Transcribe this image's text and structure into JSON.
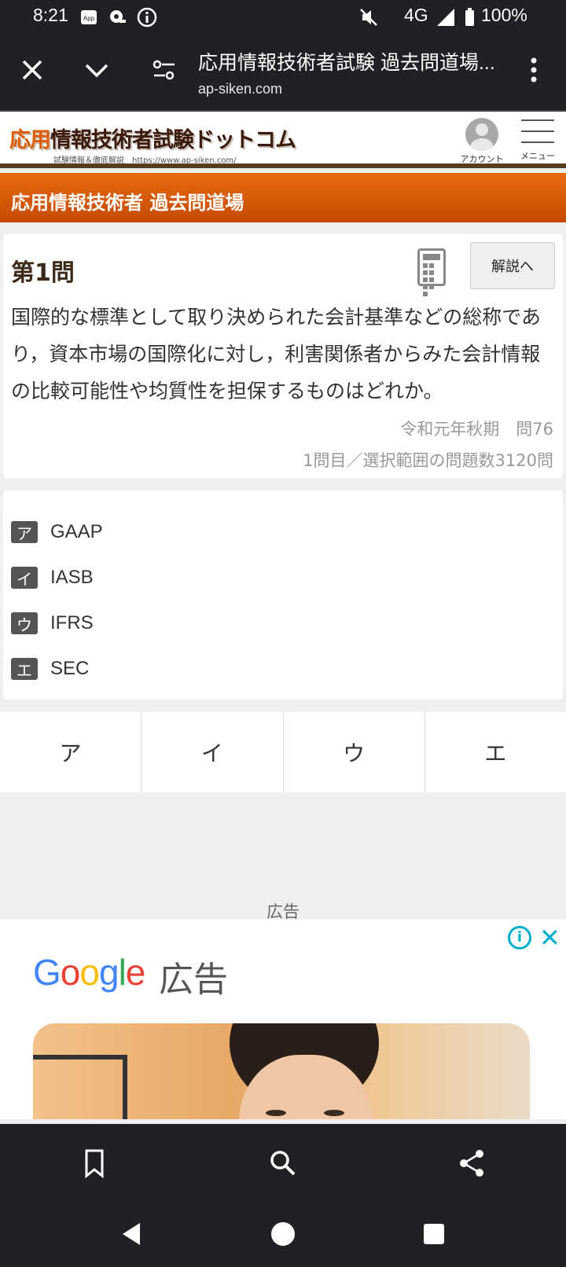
{
  "status_bar": {
    "time": "8:21",
    "network": "4G",
    "battery": "100%"
  },
  "toolbar": {
    "title": "応用情報技術者試験 過去問道場...",
    "url": "ap-siken.com"
  },
  "site": {
    "logo_accent": "応用",
    "logo_rest": "情報技術者試験ドットコム",
    "logo_sub": "試験情報＆徹底解説　https://www.ap-siken.com/",
    "account_label": "アカウント",
    "menu_label": "メニュー",
    "banner": "応用情報技術者 過去問道場"
  },
  "question": {
    "title": "第1問",
    "explain_button": "解説へ",
    "text": "国際的な標準として取り決められた会計基準などの総称であり，資本市場の国際化に対し，利害関係者からみた会計情報の比較可能性や均質性を担保するものはどれか。",
    "source": "令和元年秋期　問76",
    "progress": "1問目／選択範囲の問題数3120問"
  },
  "choices": [
    {
      "mark": "ア",
      "text": "GAAP"
    },
    {
      "mark": "イ",
      "text": "IASB"
    },
    {
      "mark": "ウ",
      "text": "IFRS"
    },
    {
      "mark": "エ",
      "text": "SEC"
    }
  ],
  "answer_buttons": [
    "ア",
    "イ",
    "ウ",
    "エ"
  ],
  "ad": {
    "label": "広告",
    "brand_parts": [
      "G",
      "o",
      "o",
      "g",
      "l",
      "e"
    ],
    "word": "広告"
  },
  "colors": {
    "accent": "#e05a00",
    "banner_start": "#e86a10",
    "banner_end": "#c44a00",
    "ad_icon": "#00aecd"
  }
}
